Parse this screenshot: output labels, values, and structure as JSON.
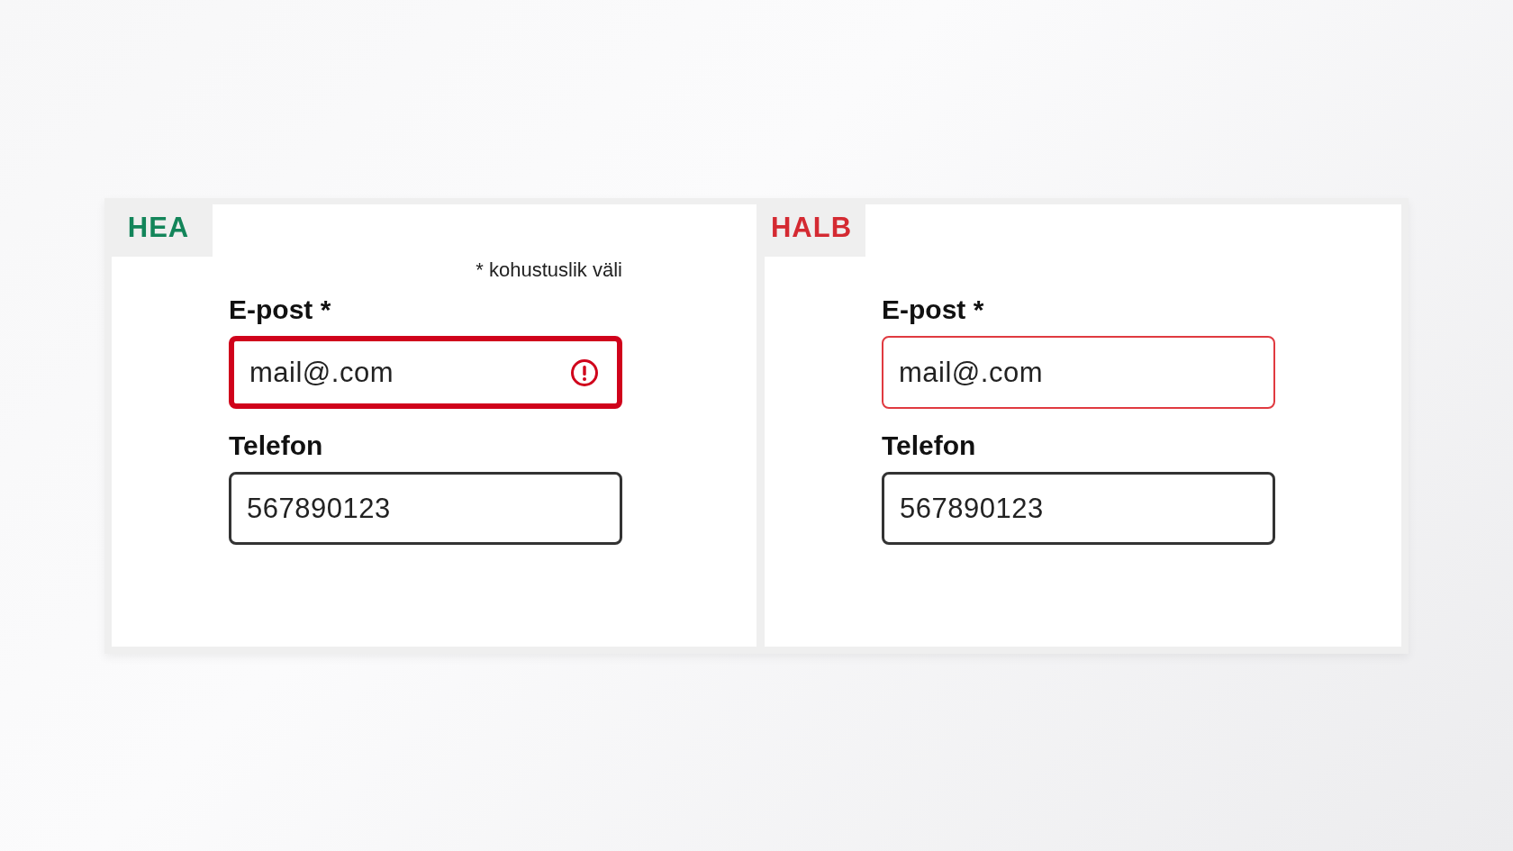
{
  "cards": [
    {
      "kind": "good",
      "label": "HEA",
      "required_note": "* kohustuslik väli",
      "fields": [
        {
          "label": "E-post *",
          "value": "mail@.com",
          "invalid": true
        },
        {
          "label": "Telefon",
          "value": "567890123",
          "invalid": false
        }
      ]
    },
    {
      "kind": "bad",
      "label": "HALB",
      "fields": [
        {
          "label": "E-post *",
          "value": "mail@.com",
          "invalid": true
        },
        {
          "label": "Telefon",
          "value": "567890123",
          "invalid": false
        }
      ]
    }
  ]
}
